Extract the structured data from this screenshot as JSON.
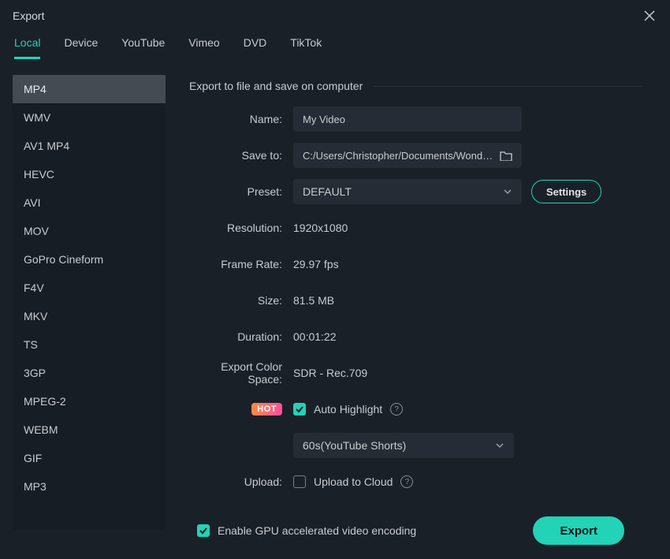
{
  "window": {
    "title": "Export"
  },
  "tabs": [
    "Local",
    "Device",
    "YouTube",
    "Vimeo",
    "DVD",
    "TikTok"
  ],
  "active_tab_index": 0,
  "formats": [
    "MP4",
    "WMV",
    "AV1 MP4",
    "HEVC",
    "AVI",
    "MOV",
    "GoPro Cineform",
    "F4V",
    "MKV",
    "TS",
    "3GP",
    "MPEG-2",
    "WEBM",
    "GIF",
    "MP3"
  ],
  "active_format_index": 0,
  "heading": "Export to file and save on computer",
  "labels": {
    "name": "Name:",
    "save_to": "Save to:",
    "preset": "Preset:",
    "resolution": "Resolution:",
    "frame_rate": "Frame Rate:",
    "size": "Size:",
    "duration": "Duration:",
    "color_space": "Export Color Space:",
    "upload": "Upload:"
  },
  "fields": {
    "name": "My Video",
    "save_to": "C:/Users/Christopher/Documents/Wondersh",
    "preset": "DEFAULT",
    "settings_btn": "Settings",
    "resolution": "1920x1080",
    "frame_rate": "29.97 fps",
    "size": "81.5 MB",
    "duration": "00:01:22",
    "color_space": "SDR - Rec.709",
    "hot_badge": "HOT",
    "auto_highlight": "Auto Highlight",
    "auto_highlight_checked": true,
    "highlight_duration": "60s(YouTube Shorts)",
    "upload_to_cloud": "Upload to Cloud",
    "upload_checked": false
  },
  "footer": {
    "gpu_label": "Enable GPU accelerated video encoding",
    "gpu_checked": true,
    "export_btn": "Export"
  }
}
